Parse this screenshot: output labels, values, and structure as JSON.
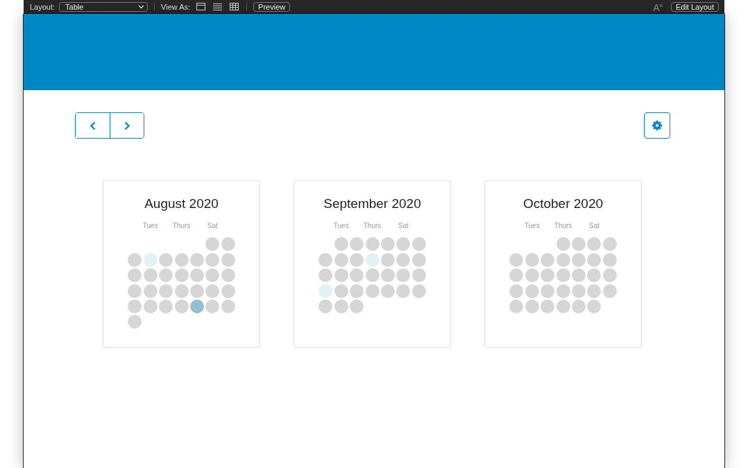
{
  "toolbar": {
    "layout_label": "Layout:",
    "layout_value": "Table",
    "view_as_label": "View As:",
    "view_buttons": [
      {
        "kind": "form",
        "selected": false
      },
      {
        "kind": "list",
        "selected": false
      },
      {
        "kind": "table",
        "selected": false
      }
    ],
    "preview_button": "Preview",
    "font_button": {
      "glyph": "A",
      "mark": "a"
    },
    "edit_layout_button": "Edit Layout"
  },
  "calendars": [
    {
      "title": "August 2020",
      "weekday_labels": [
        "Tues",
        "Thurs",
        "Sat"
      ],
      "weeks": [
        [
          {
            "kind": "empty"
          },
          {
            "kind": "empty"
          },
          {
            "kind": "empty"
          },
          {
            "kind": "empty"
          },
          {
            "kind": "empty"
          },
          {
            "kind": "day",
            "color": "#d6d6d6"
          },
          {
            "kind": "day",
            "color": "#d6d6d6"
          }
        ],
        [
          {
            "kind": "day",
            "color": "#d6d6d6"
          },
          {
            "kind": "day",
            "color": "#e1f2f7"
          },
          {
            "kind": "day",
            "color": "#d6d6d6"
          },
          {
            "kind": "day",
            "color": "#d6d6d6"
          },
          {
            "kind": "day",
            "color": "#d6d6d6"
          },
          {
            "kind": "day",
            "color": "#d6d6d6"
          },
          {
            "kind": "day",
            "color": "#d6d6d6"
          }
        ],
        [
          {
            "kind": "day",
            "color": "#d6d6d6"
          },
          {
            "kind": "day",
            "color": "#d6d6d6"
          },
          {
            "kind": "day",
            "color": "#d6d6d6"
          },
          {
            "kind": "day",
            "color": "#d6d6d6"
          },
          {
            "kind": "day",
            "color": "#d6d6d6"
          },
          {
            "kind": "day",
            "color": "#d6d6d6"
          },
          {
            "kind": "day",
            "color": "#d6d6d6"
          }
        ],
        [
          {
            "kind": "day",
            "color": "#d6d6d6"
          },
          {
            "kind": "day",
            "color": "#d6d6d6"
          },
          {
            "kind": "day",
            "color": "#d6d6d6"
          },
          {
            "kind": "day",
            "color": "#d6d6d6"
          },
          {
            "kind": "day",
            "color": "#d6d6d6"
          },
          {
            "kind": "day",
            "color": "#d6d6d6"
          },
          {
            "kind": "day",
            "color": "#d6d6d6"
          }
        ],
        [
          {
            "kind": "day",
            "color": "#d6d6d6"
          },
          {
            "kind": "day",
            "color": "#d6d6d6"
          },
          {
            "kind": "day",
            "color": "#d6d6d6"
          },
          {
            "kind": "day",
            "color": "#d6d6d6"
          },
          {
            "kind": "day",
            "color": "#8fc1d0"
          },
          {
            "kind": "day",
            "color": "#d6d6d6"
          },
          {
            "kind": "day",
            "color": "#d6d6d6"
          }
        ],
        [
          {
            "kind": "day",
            "color": "#d6d6d6"
          }
        ]
      ]
    },
    {
      "title": "September 2020",
      "weekday_labels": [
        "Tues",
        "Thurs",
        "Sat"
      ],
      "weeks": [
        [
          {
            "kind": "empty"
          },
          {
            "kind": "day",
            "color": "#d6d6d6"
          },
          {
            "kind": "day",
            "color": "#d6d6d6"
          },
          {
            "kind": "day",
            "color": "#d6d6d6"
          },
          {
            "kind": "day",
            "color": "#d6d6d6"
          },
          {
            "kind": "day",
            "color": "#d6d6d6"
          },
          {
            "kind": "day",
            "color": "#d6d6d6"
          }
        ],
        [
          {
            "kind": "day",
            "color": "#d6d6d6"
          },
          {
            "kind": "day",
            "color": "#d6d6d6"
          },
          {
            "kind": "day",
            "color": "#d6d6d6"
          },
          {
            "kind": "day",
            "color": "#e1f2f7"
          },
          {
            "kind": "day",
            "color": "#d6d6d6"
          },
          {
            "kind": "day",
            "color": "#d6d6d6"
          },
          {
            "kind": "day",
            "color": "#d6d6d6"
          }
        ],
        [
          {
            "kind": "day",
            "color": "#d6d6d6"
          },
          {
            "kind": "day",
            "color": "#d6d6d6"
          },
          {
            "kind": "day",
            "color": "#d6d6d6"
          },
          {
            "kind": "day",
            "color": "#d6d6d6"
          },
          {
            "kind": "day",
            "color": "#d6d6d6"
          },
          {
            "kind": "day",
            "color": "#d6d6d6"
          },
          {
            "kind": "day",
            "color": "#d6d6d6"
          }
        ],
        [
          {
            "kind": "day",
            "color": "#e1f2f7"
          },
          {
            "kind": "day",
            "color": "#d6d6d6"
          },
          {
            "kind": "day",
            "color": "#d6d6d6"
          },
          {
            "kind": "day",
            "color": "#d6d6d6"
          },
          {
            "kind": "day",
            "color": "#d6d6d6"
          },
          {
            "kind": "day",
            "color": "#d6d6d6"
          },
          {
            "kind": "day",
            "color": "#d6d6d6"
          }
        ],
        [
          {
            "kind": "day",
            "color": "#d6d6d6"
          },
          {
            "kind": "day",
            "color": "#d6d6d6"
          },
          {
            "kind": "day",
            "color": "#d6d6d6"
          }
        ]
      ]
    },
    {
      "title": "October 2020",
      "weekday_labels": [
        "Tues",
        "Thurs",
        "Sat"
      ],
      "weeks": [
        [
          {
            "kind": "empty"
          },
          {
            "kind": "empty"
          },
          {
            "kind": "empty"
          },
          {
            "kind": "day",
            "color": "#d6d6d6"
          },
          {
            "kind": "day",
            "color": "#d6d6d6"
          },
          {
            "kind": "day",
            "color": "#d6d6d6"
          },
          {
            "kind": "day",
            "color": "#d6d6d6"
          }
        ],
        [
          {
            "kind": "day",
            "color": "#d6d6d6"
          },
          {
            "kind": "day",
            "color": "#d6d6d6"
          },
          {
            "kind": "day",
            "color": "#d6d6d6"
          },
          {
            "kind": "day",
            "color": "#d6d6d6"
          },
          {
            "kind": "day",
            "color": "#d6d6d6"
          },
          {
            "kind": "day",
            "color": "#d6d6d6"
          },
          {
            "kind": "day",
            "color": "#d6d6d6"
          }
        ],
        [
          {
            "kind": "day",
            "color": "#d6d6d6"
          },
          {
            "kind": "day",
            "color": "#d6d6d6"
          },
          {
            "kind": "day",
            "color": "#d6d6d6"
          },
          {
            "kind": "day",
            "color": "#d6d6d6"
          },
          {
            "kind": "day",
            "color": "#d6d6d6"
          },
          {
            "kind": "day",
            "color": "#d6d6d6"
          },
          {
            "kind": "day",
            "color": "#d6d6d6"
          }
        ],
        [
          {
            "kind": "day",
            "color": "#d6d6d6"
          },
          {
            "kind": "day",
            "color": "#d6d6d6"
          },
          {
            "kind": "day",
            "color": "#d6d6d6"
          },
          {
            "kind": "day",
            "color": "#d6d6d6"
          },
          {
            "kind": "day",
            "color": "#d6d6d6"
          },
          {
            "kind": "day",
            "color": "#d6d6d6"
          },
          {
            "kind": "day",
            "color": "#d6d6d6"
          }
        ],
        [
          {
            "kind": "day",
            "color": "#d6d6d6"
          },
          {
            "kind": "day",
            "color": "#d6d6d6"
          },
          {
            "kind": "day",
            "color": "#d6d6d6"
          },
          {
            "kind": "day",
            "color": "#d6d6d6"
          },
          {
            "kind": "day",
            "color": "#d6d6d6"
          },
          {
            "kind": "day",
            "color": "#d6d6d6"
          }
        ]
      ]
    }
  ]
}
